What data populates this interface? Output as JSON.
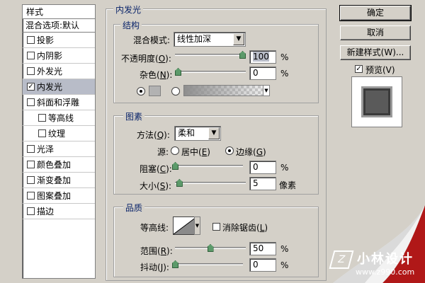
{
  "style_list": {
    "header": "样式",
    "blend_options": "混合选项:默认",
    "items": [
      {
        "label": "投影",
        "checked": false,
        "indent": false
      },
      {
        "label": "内阴影",
        "checked": false,
        "indent": false
      },
      {
        "label": "外发光",
        "checked": false,
        "indent": false
      },
      {
        "label": "内发光",
        "checked": true,
        "indent": false,
        "selected": true
      },
      {
        "label": "斜面和浮雕",
        "checked": false,
        "indent": false
      },
      {
        "label": "等高线",
        "checked": false,
        "indent": true
      },
      {
        "label": "纹理",
        "checked": false,
        "indent": true
      },
      {
        "label": "光泽",
        "checked": false,
        "indent": false
      },
      {
        "label": "颜色叠加",
        "checked": false,
        "indent": false
      },
      {
        "label": "渐变叠加",
        "checked": false,
        "indent": false
      },
      {
        "label": "图案叠加",
        "checked": false,
        "indent": false
      },
      {
        "label": "描边",
        "checked": false,
        "indent": false
      }
    ]
  },
  "panel": {
    "title": "内发光",
    "structure": {
      "title": "结构",
      "blend_mode_label": "混合模式:",
      "blend_mode_value": "线性加深",
      "opacity_label": "不透明度(O):",
      "opacity_value": "100",
      "opacity_fraction": 1.0,
      "noise_label": "杂色(N):",
      "noise_value": "0",
      "noise_fraction": 0.0,
      "percent": "%",
      "swatch_color": "#b2b2b2"
    },
    "elements": {
      "title": "图素",
      "method_label": "方法(Q):",
      "method_value": "柔和",
      "source_label": "源:",
      "source_center": "居中(E)",
      "source_edge": "边缘(G)",
      "choke_label": "阻塞(C):",
      "choke_value": "0",
      "choke_fraction": 0.0,
      "size_label": "大小(S):",
      "size_value": "5",
      "size_fraction": 0.02,
      "size_unit": "像素",
      "percent": "%"
    },
    "quality": {
      "title": "品质",
      "contour_label": "等高线:",
      "antialias_label": "消除锯齿(L)",
      "range_label": "范围(R):",
      "range_value": "50",
      "range_fraction": 0.5,
      "jitter_label": "抖动(J):",
      "jitter_value": "0",
      "jitter_fraction": 0.0,
      "percent": "%"
    }
  },
  "buttons": {
    "ok": "确定",
    "cancel": "取消",
    "new_style": "新建样式(W)...",
    "preview_label": "预览(V)",
    "preview_checked": true
  },
  "watermark": {
    "brand": "小林设计",
    "url": "www.z990.com",
    "logo": "Z"
  },
  "colors": {
    "accent": "#0a246a",
    "slider_thumb": "#5c9a6a",
    "selection": "#b8bcc8",
    "watermark_red": "#b01818"
  }
}
